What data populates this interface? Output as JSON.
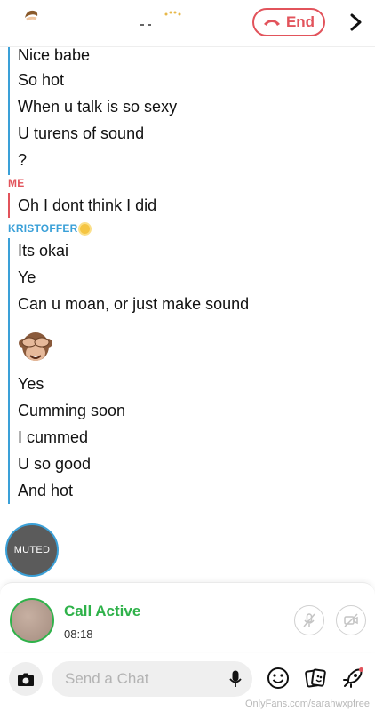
{
  "header": {
    "end_label": "End",
    "accent_color": "#e2535b"
  },
  "messages": {
    "top_group_lines": [
      "Nice babe",
      "So hot",
      "When u talk is so sexy",
      "U turens of sound",
      "?"
    ],
    "me_sender": "ME",
    "me_lines": [
      "Oh I dont think I did"
    ],
    "k_sender": "KRISTOFFER",
    "k_lines_a": [
      "Its okai",
      "Ye",
      "Can u moan, or just make sound"
    ],
    "k_emoji": "see-no-evil-monkey",
    "k_lines_b": [
      "Yes",
      "Cumming soon",
      "I cummed",
      "U so good",
      "And hot"
    ]
  },
  "muted_label": "MUTED",
  "call": {
    "title": "Call Active",
    "timer": "08:18",
    "status_color": "#2fb24a"
  },
  "bottom_bar": {
    "placeholder": "Send a Chat"
  },
  "watermark": "OnlyFans.com/sarahwxpfree",
  "colors": {
    "friend_blue": "#3aa0d8",
    "me_red": "#e2535b"
  }
}
